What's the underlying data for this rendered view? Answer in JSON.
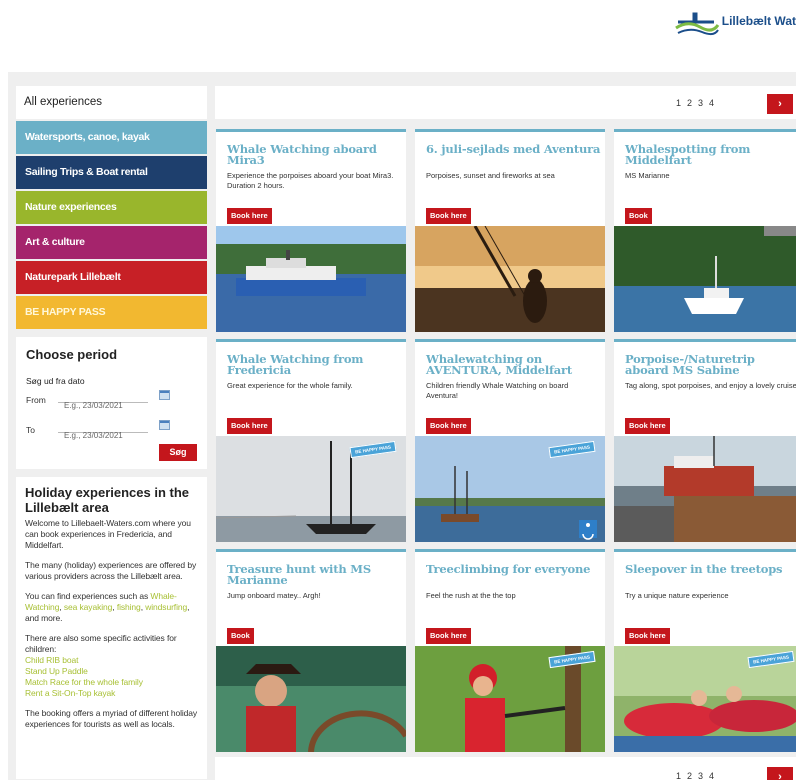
{
  "header": {
    "logo_name": "Lillebælt Wat"
  },
  "sidebar": {
    "all_experiences": "All experiences",
    "categories": [
      "Watersports, canoe, kayak",
      "Sailing Trips & Boat rental",
      "Nature experiences",
      "Art & culture",
      "Naturepark Lillebælt",
      "BE HAPPY PASS"
    ],
    "period": {
      "title": "Choose period",
      "sub": "Søg ud fra dato",
      "from_label": "From",
      "to_label": "To",
      "from_placeholder": "E.g., 23/03/2021",
      "to_placeholder": "E.g., 23/03/2021",
      "search_label": "Søg"
    },
    "holiday": {
      "title": "Holiday experiences in the Lillebælt area",
      "p1": "Welcome to Lillebaelt-Waters.com where you can book experiences in Fredericia, and Middelfart.",
      "p2": "The many (holiday) experiences are offered by various providers across the Lillebælt area.",
      "p3_pre": "You can find experiences such as ",
      "p3_links": [
        "Whale-Watching",
        "sea kayaking",
        "fishing",
        "windsurfing"
      ],
      "p3_post": ", and more.",
      "p4": "There are also some specific activities for children:",
      "kids_links": [
        "Child RIB boat",
        "Stand Up Paddle",
        "Match Race for the whole family",
        "Rent a Sit-On-Top kayak"
      ],
      "p5": "The booking offers a myriad of different holiday experiences for tourists as well as locals."
    }
  },
  "pagination": {
    "pages": [
      "1",
      "2",
      "3",
      "4"
    ],
    "next": "›"
  },
  "cards": [
    {
      "title": "Whale Watching aboard Mira3",
      "desc": "Experience the porpoises aboard your boat Mira3. Duration 2 hours.",
      "button": "Book here",
      "badge": ""
    },
    {
      "title": "6. juli-sejlads med Aventura",
      "desc": "Porpoises, sunset and fireworks at sea",
      "button": "Book here",
      "badge": ""
    },
    {
      "title": "Whalespotting from Middelfart",
      "desc": "MS Marianne",
      "button": "Book",
      "badge": ""
    },
    {
      "title": "Whale Watching from Fredericia",
      "desc": "Great experience for the whole family.",
      "button": "Book here",
      "badge": "BE HAPPY PASS"
    },
    {
      "title": "Whalewatching on AVENTURA, Middelfart",
      "desc": "Children friendly Whale Watching on board Aventura!",
      "button": "Book here",
      "badge": "BE HAPPY PASS"
    },
    {
      "title": "Porpoise-/Naturetrip aboard MS Sabine",
      "desc": "Tag along, spot porpoises, and enjoy a lovely cruise",
      "button": "Book here",
      "badge": ""
    },
    {
      "title": "Treasure hunt with MS Marianne",
      "desc": "Jump onboard matey.. Argh!",
      "button": "Book",
      "badge": ""
    },
    {
      "title": "Treeclimbing for everyone",
      "desc": "Feel the rush at the the top",
      "button": "Book here",
      "badge": "BE HAPPY PASS"
    },
    {
      "title": "Sleepover in the treetops",
      "desc": "Try a unique nature experience",
      "button": "Book here",
      "badge": "BE HAPPY PASS"
    }
  ],
  "colors": {
    "accent_blue": "#6bb0c7",
    "book_red": "#c4161c",
    "link_green": "#a8c035"
  }
}
